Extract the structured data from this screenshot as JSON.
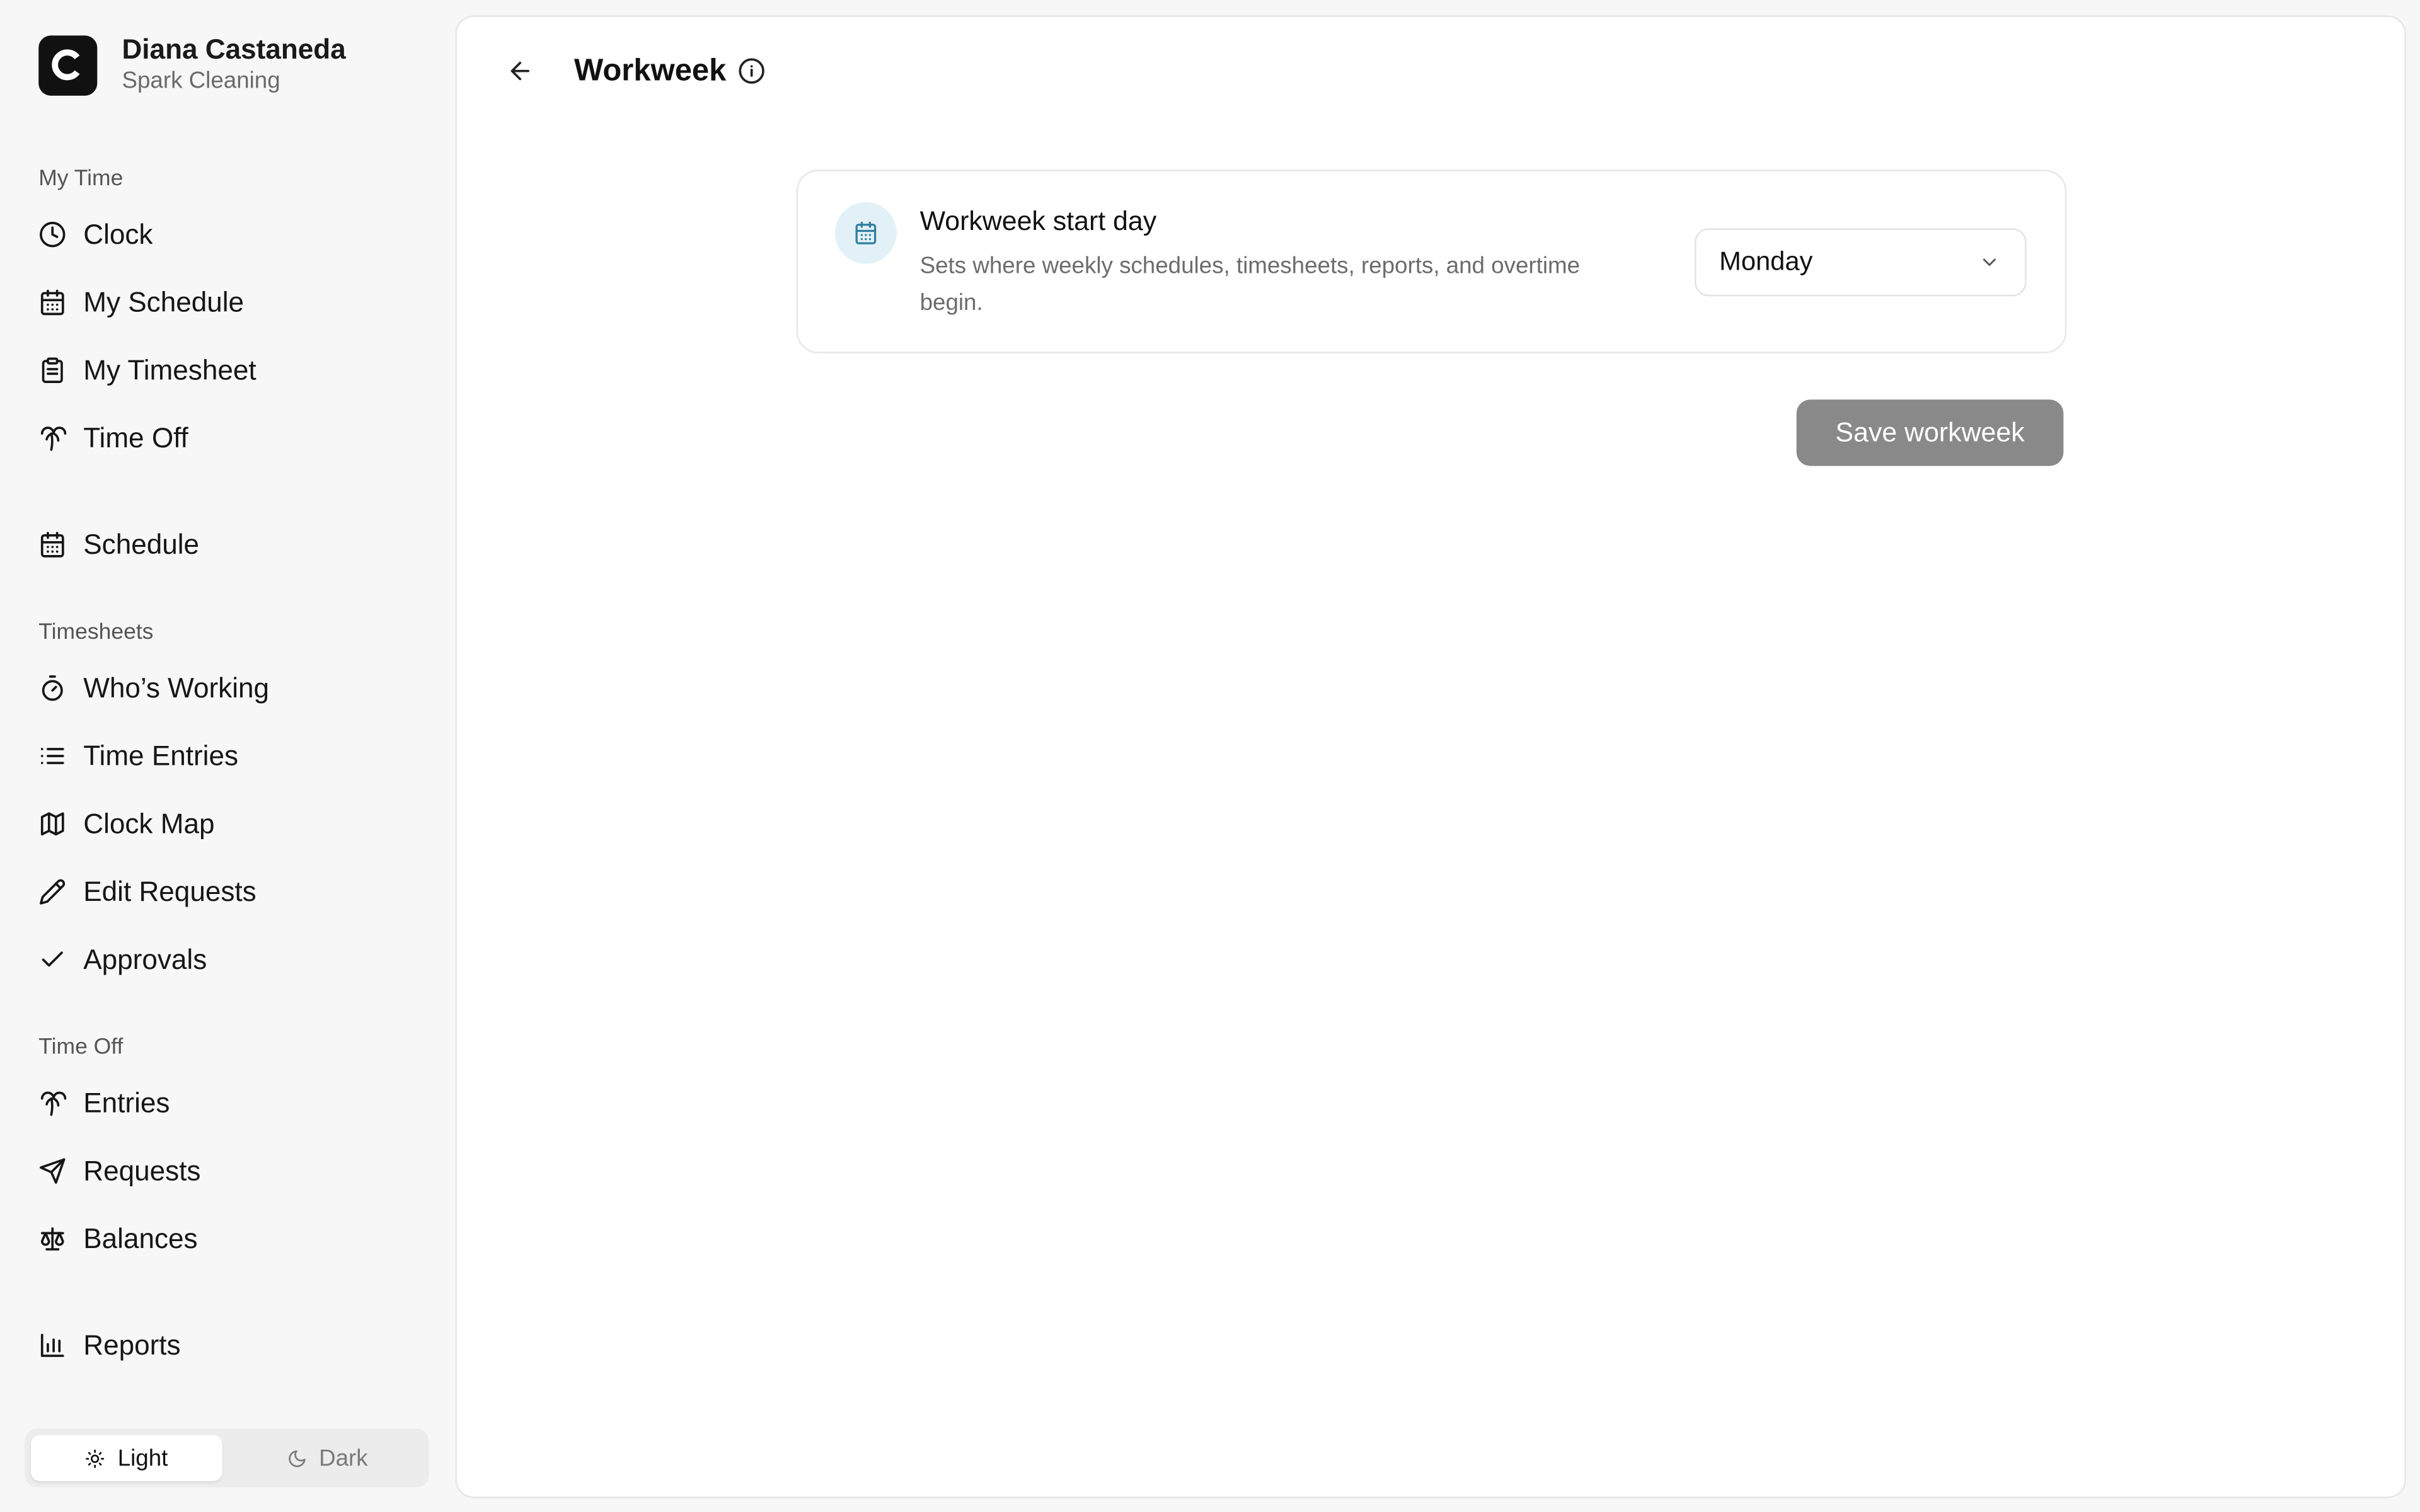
{
  "user": {
    "name": "Diana Castaneda",
    "organization": "Spark Cleaning",
    "logo_letter": "C"
  },
  "sidebar": {
    "sections": [
      {
        "title": "My Time"
      },
      {
        "title": "Timesheets"
      },
      {
        "title": "Time Off"
      }
    ],
    "items": [
      {
        "label": "Clock",
        "icon": "clock-icon"
      },
      {
        "label": "My Schedule",
        "icon": "calendar-icon"
      },
      {
        "label": "My Timesheet",
        "icon": "clipboard-icon"
      },
      {
        "label": "Time Off",
        "icon": "palm-tree-icon"
      },
      {
        "label": "Schedule",
        "icon": "calendar-icon"
      },
      {
        "label": "Who’s Working",
        "icon": "stopwatch-icon"
      },
      {
        "label": "Time Entries",
        "icon": "list-icon"
      },
      {
        "label": "Clock Map",
        "icon": "map-icon"
      },
      {
        "label": "Edit Requests",
        "icon": "pencil-icon"
      },
      {
        "label": "Approvals",
        "icon": "check-icon"
      },
      {
        "label": "Entries",
        "icon": "palm-tree-icon"
      },
      {
        "label": "Requests",
        "icon": "send-icon"
      },
      {
        "label": "Balances",
        "icon": "scale-icon"
      },
      {
        "label": "Reports",
        "icon": "bar-chart-icon"
      }
    ]
  },
  "theme": {
    "light_label": "Light",
    "dark_label": "Dark",
    "selected": "Light"
  },
  "page": {
    "title": "Workweek"
  },
  "workweek_card": {
    "title": "Workweek start day",
    "description": "Sets where weekly schedules, timesheets, reports, and overtime begin.",
    "icon": "calendar-icon",
    "selected_day": "Monday"
  },
  "actions": {
    "save_label": "Save workweek"
  },
  "colors": {
    "accent_icon_bg": "#e2f1f7",
    "accent_icon": "#2f7f9e",
    "save_button_disabled": "#898989"
  }
}
